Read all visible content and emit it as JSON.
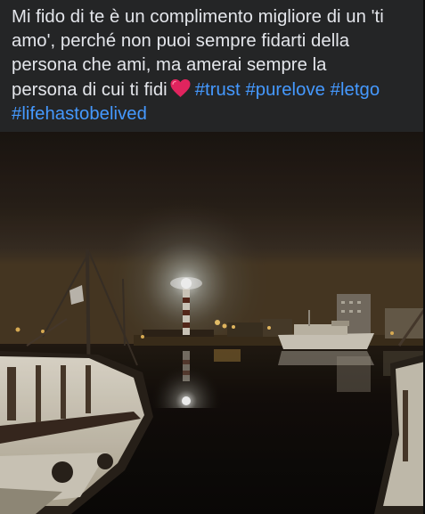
{
  "post": {
    "caption": {
      "line1": "Mi fido di te è un complimento migliore di un 'ti",
      "line2": "amo', perché non puoi sempre fidarti della",
      "line3": "persona che ami,  ma amerai sempre la",
      "line4_text": "persona di cui ti fidi",
      "emoji": "red-heart-emoji",
      "hashtags": [
        "#trust",
        "#purelove",
        "#letgo",
        "#lifehastobelived"
      ]
    },
    "photo": {
      "subject": "harbor-at-night-with-lighthouse",
      "colors": {
        "sky_top": "#2a2119",
        "sky_glow": "#8f8f86",
        "water": "#0e0b09",
        "light": "#ffffff",
        "warm_lights": "#f2c466"
      }
    },
    "colors": {
      "background": "#242526",
      "text": "#e4e6eb",
      "hashtag": "#4599ff",
      "heart": "#e0245e"
    }
  }
}
